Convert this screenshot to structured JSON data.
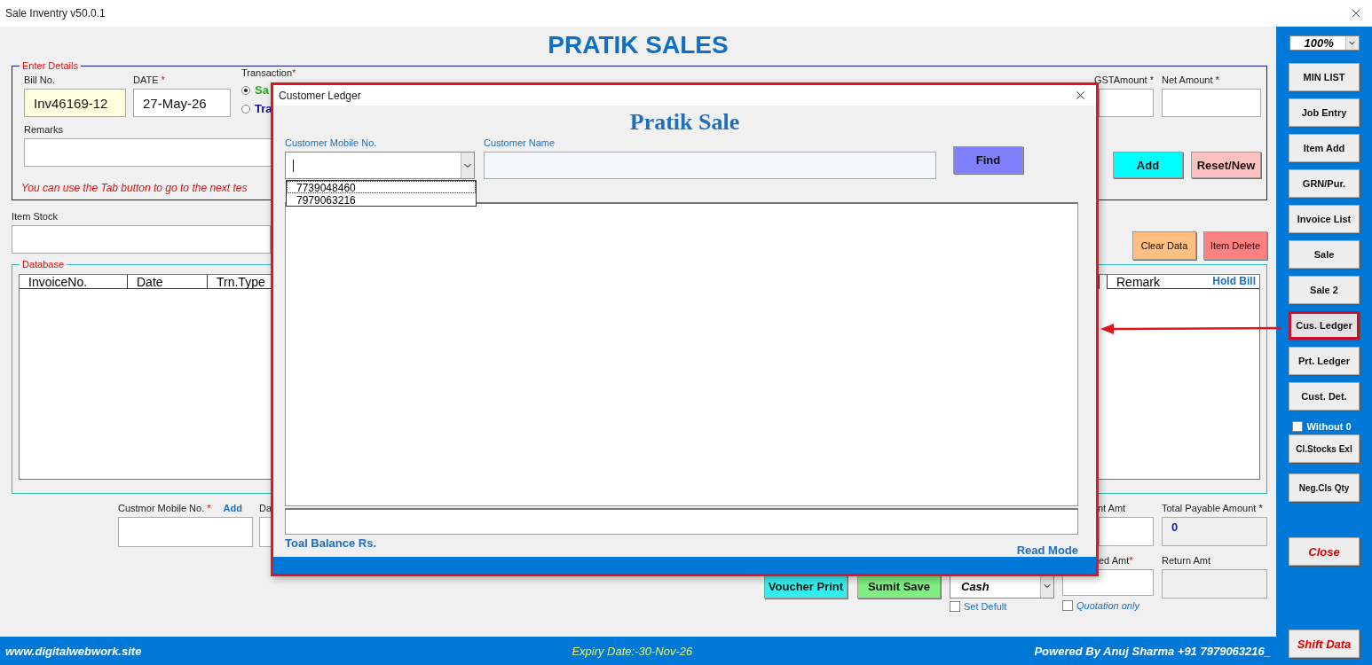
{
  "window": {
    "title": "Sale Inventry v50.0.1"
  },
  "heading": "PRATIK SALES",
  "details": {
    "legend": "Enter Details",
    "bill_no": {
      "label": "Bill No.",
      "value": "Inv46169-12"
    },
    "date": {
      "label": "DATE",
      "required": "*",
      "value": "27-May-26"
    },
    "transaction": {
      "label": "Transaction",
      "required": "*",
      "options": [
        {
          "label": "Sa",
          "selected": true
        },
        {
          "label": "Tra",
          "selected": false
        }
      ]
    },
    "gst_amount": {
      "label": "GSTAmount *"
    },
    "net_amount": {
      "label": "Net Amount *"
    },
    "remarks": {
      "label": "Remarks"
    },
    "hint": "You can use the Tab button to go to the next tes",
    "buttons": [
      {
        "label": "Add",
        "kind": "add"
      },
      {
        "label": "Reset/New",
        "kind": "reset"
      }
    ]
  },
  "item_stock": {
    "label": "Item Stock",
    "buttons": [
      {
        "label": "Clear Data",
        "kind": "clear"
      },
      {
        "label": "Item Delete",
        "kind": "delete"
      }
    ]
  },
  "database": {
    "legend": "Database",
    "hold_bill": "Hold Bill",
    "columns": [
      "InvoiceNo.",
      "Date",
      "Trn.Type",
      "Remark"
    ]
  },
  "bottom": {
    "mobile": {
      "label": "Custmor Mobile No.",
      "required": "*",
      "add": "Add"
    },
    "date_label": "Da",
    "amount_label": "nt Amt",
    "total_payable": {
      "label": "Total Payable Amount *",
      "value": "0"
    },
    "received": {
      "label": "ed Amt",
      "required": "*"
    },
    "return_amt": {
      "label": "Return Amt"
    },
    "buttons": [
      {
        "label": "Voucher Print",
        "kind": "print"
      },
      {
        "label": "Sumit Save",
        "kind": "save"
      }
    ],
    "payment": {
      "value": "Cash"
    },
    "checks": [
      {
        "label": "Set Defult",
        "checked": false
      },
      {
        "label": "Quotation only",
        "checked": false
      }
    ]
  },
  "footer": {
    "site": "www.digitalwebwork.site",
    "expiry": "Expiry Date:-30-Nov-26",
    "credit": "Powered By Anuj Sharma +91 7979063216_"
  },
  "sidebar": {
    "zoom": "100%",
    "nav": [
      {
        "label": "MIN LIST",
        "selected": false
      },
      {
        "label": "Job Entry",
        "selected": false
      },
      {
        "label": "Item Add",
        "selected": false
      },
      {
        "label": "GRN/Pur.",
        "selected": false
      },
      {
        "label": "Invoice List",
        "selected": false
      },
      {
        "label": "Sale",
        "selected": false
      },
      {
        "label": "Sale 2",
        "selected": false
      },
      {
        "label": "Cus. Ledger",
        "selected": true
      },
      {
        "label": "Prt. Ledger",
        "selected": false
      },
      {
        "label": "Cust. Det.",
        "selected": false
      }
    ],
    "without_zero": {
      "label": "Without 0",
      "checked": false
    },
    "tools": [
      "Cl.Stocks Exl",
      "Neg.Cls Qty"
    ],
    "actions": [
      "Close",
      "Shift Data"
    ]
  },
  "dialog": {
    "title": "Customer Ledger",
    "heading": "Pratik Sale",
    "mobile_label": "Customer Mobile No.",
    "name_label": "Customer Name",
    "find": "Find",
    "mobile_options": [
      {
        "label": "7739048460",
        "selected": true
      },
      {
        "label": "7979063216",
        "selected": false
      }
    ],
    "total_label": "Toal Balance Rs.",
    "mode": "Read Mode"
  }
}
